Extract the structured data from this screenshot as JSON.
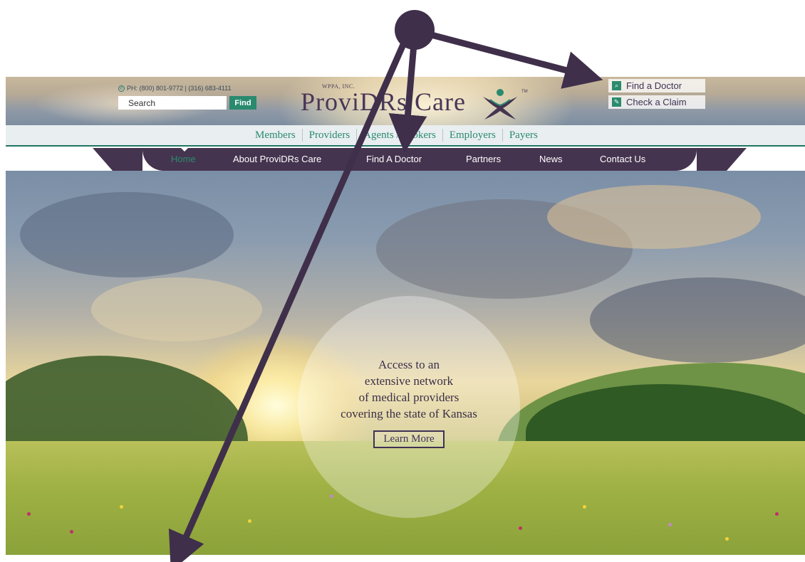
{
  "header": {
    "phone_text": "PH: (800) 801-9772 | (316) 683-4111",
    "search": {
      "placeholder": "Search",
      "button_label": "Find"
    },
    "logo": {
      "tagline": "WPPA, INC.",
      "wordmark": "ProviDRs Care",
      "trademark": "TM"
    },
    "quick_links": [
      {
        "label": "Find a Doctor",
        "icon": "search-doc-icon"
      },
      {
        "label": "Check a Claim",
        "icon": "edit-icon"
      }
    ]
  },
  "subnav": {
    "items": [
      "Members",
      "Providers",
      "Agents / Brokers",
      "Employers",
      "Payers"
    ]
  },
  "mainnav": {
    "items": [
      "Home",
      "About ProviDRs Care",
      "Find A Doctor",
      "Partners",
      "News",
      "Contact Us"
    ],
    "active_index": 0
  },
  "hero": {
    "callout_lines": [
      "Access to an",
      "extensive network",
      "of medical providers",
      "covering the state of Kansas"
    ],
    "button_label": "Learn More"
  },
  "colors": {
    "brand_purple": "#45344f",
    "brand_green": "#2a8a6e",
    "annotation_purple": "#3f2f4a"
  }
}
